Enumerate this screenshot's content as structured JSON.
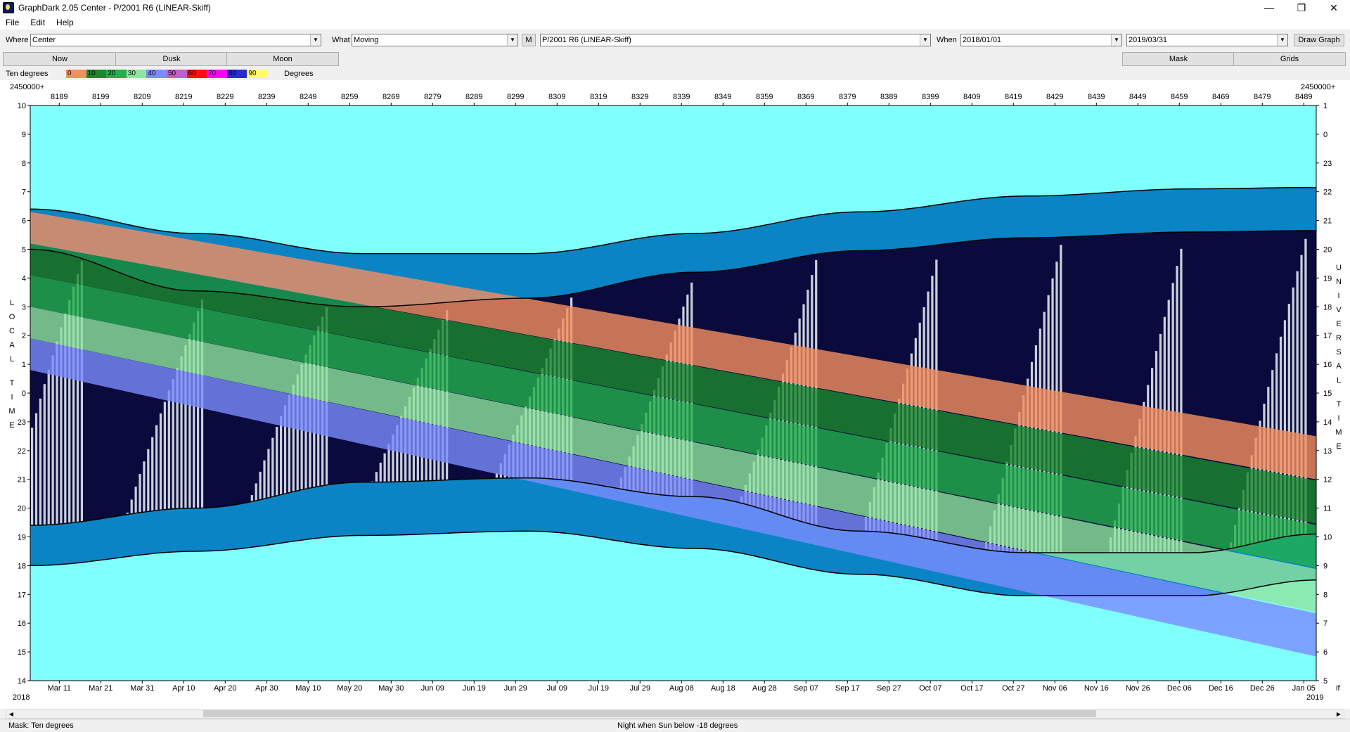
{
  "window": {
    "title": "GraphDark 2.05  Center  -  P/2001 R6 (LINEAR-Skiff)",
    "minimize": "—",
    "restore": "❐",
    "close": "✕"
  },
  "menu": [
    "File",
    "Edit",
    "Help"
  ],
  "toolbar": {
    "where_label": "Where",
    "where_value": "Center",
    "what_label": "What",
    "what_value": "Moving",
    "m_button": "M",
    "object_value": "P/2001 R6 (LINEAR-Skiff)",
    "when_label": "When",
    "start_date": "2018/01/01",
    "end_date": "2019/03/31",
    "draw_button": "Draw Graph"
  },
  "buttons_row": {
    "now": "Now",
    "dusk": "Dusk",
    "moon": "Moon",
    "mask": "Mask",
    "grids": "Grids"
  },
  "legend": {
    "title": "Ten degrees",
    "unit": "Degrees",
    "entries": [
      {
        "label": "0",
        "color": "#f58f5f"
      },
      {
        "label": "10",
        "color": "#1b8a2e"
      },
      {
        "label": "20",
        "color": "#22b14c"
      },
      {
        "label": "30",
        "color": "#8ee59e"
      },
      {
        "label": "40",
        "color": "#7b8cff"
      },
      {
        "label": "50",
        "color": "#c55cc8"
      },
      {
        "label": "60",
        "color": "#ff1010"
      },
      {
        "label": "70",
        "color": "#ff00ff"
      },
      {
        "label": "80",
        "color": "#2b2bd6"
      },
      {
        "label": "90",
        "color": "#ffff60"
      }
    ]
  },
  "chart_data": {
    "type": "heatmap",
    "title": "",
    "jd_prefix": "2450000+",
    "jd_ticks": [
      "8189",
      "8199",
      "8209",
      "8219",
      "8229",
      "8239",
      "8249",
      "8259",
      "8269",
      "8279",
      "8289",
      "8299",
      "8309",
      "8319",
      "8329",
      "8339",
      "8349",
      "8359",
      "8369",
      "8379",
      "8389",
      "8399",
      "8409",
      "8419",
      "8429",
      "8439",
      "8449",
      "8459",
      "8469",
      "8479",
      "8489"
    ],
    "date_ticks": [
      "Mar 11",
      "Mar 21",
      "Mar 31",
      "Apr 10",
      "Apr 20",
      "Apr 30",
      "May 10",
      "May 20",
      "May 30",
      "Jun 09",
      "Jun 19",
      "Jun 29",
      "Jul 09",
      "Jul 19",
      "Jul 29",
      "Aug 08",
      "Aug 18",
      "Aug 28",
      "Sep 07",
      "Sep 17",
      "Sep 27",
      "Oct 07",
      "Oct 17",
      "Oct 27",
      "Nov 06",
      "Nov 16",
      "Nov 26",
      "Dec 06",
      "Dec 16",
      "Dec 26",
      "Jan 05"
    ],
    "year_start": "2018",
    "year_end": "2019",
    "x_end_label": "if",
    "left_axis_label": "LOCAL TIME",
    "right_axis_label": "UNIVERSAL TIME",
    "left_ticks": [
      "10",
      "9",
      "8",
      "7",
      "6",
      "5",
      "4",
      "3",
      "2",
      "1",
      "0",
      "23",
      "22",
      "21",
      "20",
      "19",
      "18",
      "17",
      "16",
      "15",
      "14"
    ],
    "right_ticks": [
      "1",
      "0",
      "23",
      "22",
      "21",
      "20",
      "19",
      "18",
      "17",
      "16",
      "15",
      "14",
      "13",
      "12",
      "11",
      "10",
      "9",
      "8",
      "7",
      "6",
      "5"
    ],
    "colors": {
      "day": "#80ffff",
      "twilight": "#0a84c4",
      "night": "#0a0a3c",
      "moonlight": "#c8d0dc"
    },
    "object_altitude_bands": [
      {
        "label": "0",
        "color": "#f58f5f"
      },
      {
        "label": "10",
        "color": "#1b8a2e"
      },
      {
        "label": "20",
        "color": "#22b14c"
      },
      {
        "label": "30",
        "color": "#8ee59e"
      },
      {
        "label": "40",
        "color": "#7b8cff"
      }
    ]
  },
  "status": {
    "mask": "Mask:  Ten degrees",
    "night": "Night when Sun below -18 degrees"
  }
}
